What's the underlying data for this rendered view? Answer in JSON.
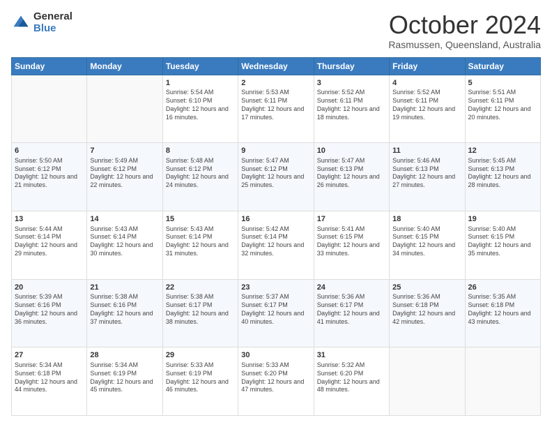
{
  "logo": {
    "general": "General",
    "blue": "Blue"
  },
  "header": {
    "month": "October 2024",
    "location": "Rasmussen, Queensland, Australia"
  },
  "days_of_week": [
    "Sunday",
    "Monday",
    "Tuesday",
    "Wednesday",
    "Thursday",
    "Friday",
    "Saturday"
  ],
  "weeks": [
    [
      {
        "day": "",
        "sunrise": "",
        "sunset": "",
        "daylight": ""
      },
      {
        "day": "",
        "sunrise": "",
        "sunset": "",
        "daylight": ""
      },
      {
        "day": "1",
        "sunrise": "Sunrise: 5:54 AM",
        "sunset": "Sunset: 6:10 PM",
        "daylight": "Daylight: 12 hours and 16 minutes."
      },
      {
        "day": "2",
        "sunrise": "Sunrise: 5:53 AM",
        "sunset": "Sunset: 6:11 PM",
        "daylight": "Daylight: 12 hours and 17 minutes."
      },
      {
        "day": "3",
        "sunrise": "Sunrise: 5:52 AM",
        "sunset": "Sunset: 6:11 PM",
        "daylight": "Daylight: 12 hours and 18 minutes."
      },
      {
        "day": "4",
        "sunrise": "Sunrise: 5:52 AM",
        "sunset": "Sunset: 6:11 PM",
        "daylight": "Daylight: 12 hours and 19 minutes."
      },
      {
        "day": "5",
        "sunrise": "Sunrise: 5:51 AM",
        "sunset": "Sunset: 6:11 PM",
        "daylight": "Daylight: 12 hours and 20 minutes."
      }
    ],
    [
      {
        "day": "6",
        "sunrise": "Sunrise: 5:50 AM",
        "sunset": "Sunset: 6:12 PM",
        "daylight": "Daylight: 12 hours and 21 minutes."
      },
      {
        "day": "7",
        "sunrise": "Sunrise: 5:49 AM",
        "sunset": "Sunset: 6:12 PM",
        "daylight": "Daylight: 12 hours and 22 minutes."
      },
      {
        "day": "8",
        "sunrise": "Sunrise: 5:48 AM",
        "sunset": "Sunset: 6:12 PM",
        "daylight": "Daylight: 12 hours and 24 minutes."
      },
      {
        "day": "9",
        "sunrise": "Sunrise: 5:47 AM",
        "sunset": "Sunset: 6:12 PM",
        "daylight": "Daylight: 12 hours and 25 minutes."
      },
      {
        "day": "10",
        "sunrise": "Sunrise: 5:47 AM",
        "sunset": "Sunset: 6:13 PM",
        "daylight": "Daylight: 12 hours and 26 minutes."
      },
      {
        "day": "11",
        "sunrise": "Sunrise: 5:46 AM",
        "sunset": "Sunset: 6:13 PM",
        "daylight": "Daylight: 12 hours and 27 minutes."
      },
      {
        "day": "12",
        "sunrise": "Sunrise: 5:45 AM",
        "sunset": "Sunset: 6:13 PM",
        "daylight": "Daylight: 12 hours and 28 minutes."
      }
    ],
    [
      {
        "day": "13",
        "sunrise": "Sunrise: 5:44 AM",
        "sunset": "Sunset: 6:14 PM",
        "daylight": "Daylight: 12 hours and 29 minutes."
      },
      {
        "day": "14",
        "sunrise": "Sunrise: 5:43 AM",
        "sunset": "Sunset: 6:14 PM",
        "daylight": "Daylight: 12 hours and 30 minutes."
      },
      {
        "day": "15",
        "sunrise": "Sunrise: 5:43 AM",
        "sunset": "Sunset: 6:14 PM",
        "daylight": "Daylight: 12 hours and 31 minutes."
      },
      {
        "day": "16",
        "sunrise": "Sunrise: 5:42 AM",
        "sunset": "Sunset: 6:14 PM",
        "daylight": "Daylight: 12 hours and 32 minutes."
      },
      {
        "day": "17",
        "sunrise": "Sunrise: 5:41 AM",
        "sunset": "Sunset: 6:15 PM",
        "daylight": "Daylight: 12 hours and 33 minutes."
      },
      {
        "day": "18",
        "sunrise": "Sunrise: 5:40 AM",
        "sunset": "Sunset: 6:15 PM",
        "daylight": "Daylight: 12 hours and 34 minutes."
      },
      {
        "day": "19",
        "sunrise": "Sunrise: 5:40 AM",
        "sunset": "Sunset: 6:15 PM",
        "daylight": "Daylight: 12 hours and 35 minutes."
      }
    ],
    [
      {
        "day": "20",
        "sunrise": "Sunrise: 5:39 AM",
        "sunset": "Sunset: 6:16 PM",
        "daylight": "Daylight: 12 hours and 36 minutes."
      },
      {
        "day": "21",
        "sunrise": "Sunrise: 5:38 AM",
        "sunset": "Sunset: 6:16 PM",
        "daylight": "Daylight: 12 hours and 37 minutes."
      },
      {
        "day": "22",
        "sunrise": "Sunrise: 5:38 AM",
        "sunset": "Sunset: 6:17 PM",
        "daylight": "Daylight: 12 hours and 38 minutes."
      },
      {
        "day": "23",
        "sunrise": "Sunrise: 5:37 AM",
        "sunset": "Sunset: 6:17 PM",
        "daylight": "Daylight: 12 hours and 40 minutes."
      },
      {
        "day": "24",
        "sunrise": "Sunrise: 5:36 AM",
        "sunset": "Sunset: 6:17 PM",
        "daylight": "Daylight: 12 hours and 41 minutes."
      },
      {
        "day": "25",
        "sunrise": "Sunrise: 5:36 AM",
        "sunset": "Sunset: 6:18 PM",
        "daylight": "Daylight: 12 hours and 42 minutes."
      },
      {
        "day": "26",
        "sunrise": "Sunrise: 5:35 AM",
        "sunset": "Sunset: 6:18 PM",
        "daylight": "Daylight: 12 hours and 43 minutes."
      }
    ],
    [
      {
        "day": "27",
        "sunrise": "Sunrise: 5:34 AM",
        "sunset": "Sunset: 6:18 PM",
        "daylight": "Daylight: 12 hours and 44 minutes."
      },
      {
        "day": "28",
        "sunrise": "Sunrise: 5:34 AM",
        "sunset": "Sunset: 6:19 PM",
        "daylight": "Daylight: 12 hours and 45 minutes."
      },
      {
        "day": "29",
        "sunrise": "Sunrise: 5:33 AM",
        "sunset": "Sunset: 6:19 PM",
        "daylight": "Daylight: 12 hours and 46 minutes."
      },
      {
        "day": "30",
        "sunrise": "Sunrise: 5:33 AM",
        "sunset": "Sunset: 6:20 PM",
        "daylight": "Daylight: 12 hours and 47 minutes."
      },
      {
        "day": "31",
        "sunrise": "Sunrise: 5:32 AM",
        "sunset": "Sunset: 6:20 PM",
        "daylight": "Daylight: 12 hours and 48 minutes."
      },
      {
        "day": "",
        "sunrise": "",
        "sunset": "",
        "daylight": ""
      },
      {
        "day": "",
        "sunrise": "",
        "sunset": "",
        "daylight": ""
      }
    ]
  ]
}
